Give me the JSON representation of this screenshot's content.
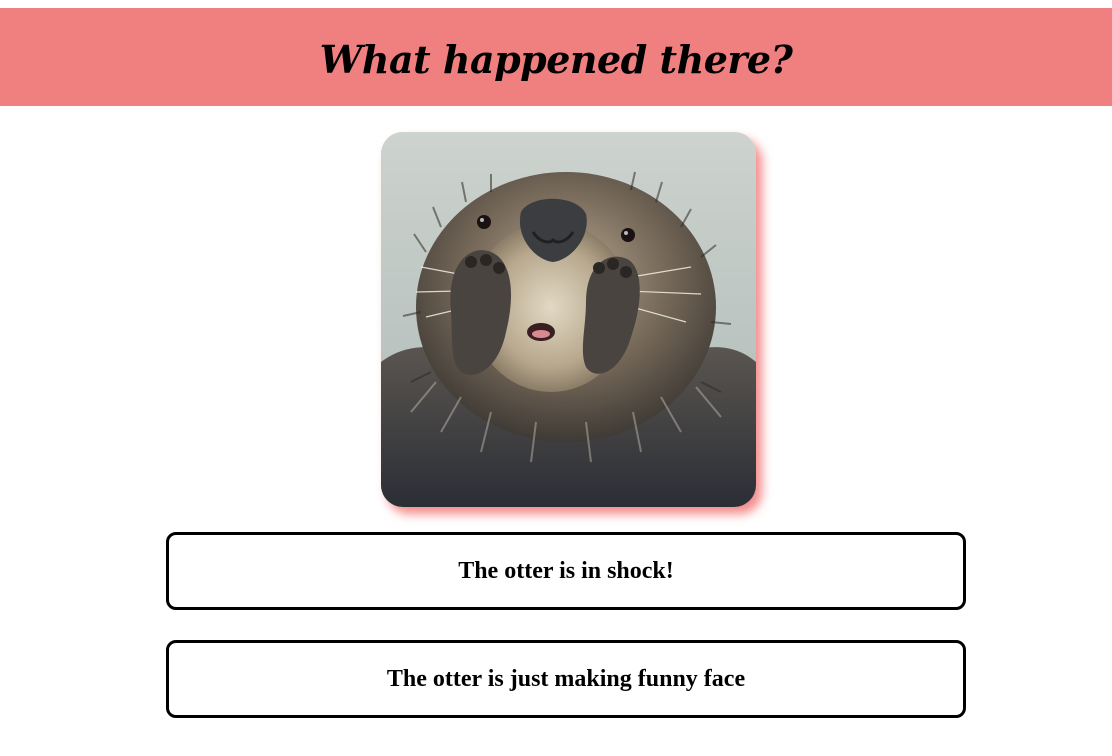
{
  "header": {
    "title": "What happened there?",
    "background_color": "#f08080"
  },
  "question": {
    "image": {
      "subject": "otter-photo",
      "accent_shadow_color": "#f06464"
    }
  },
  "answers": [
    {
      "label": "The otter is in shock!"
    },
    {
      "label": "The otter is just making funny face"
    }
  ]
}
